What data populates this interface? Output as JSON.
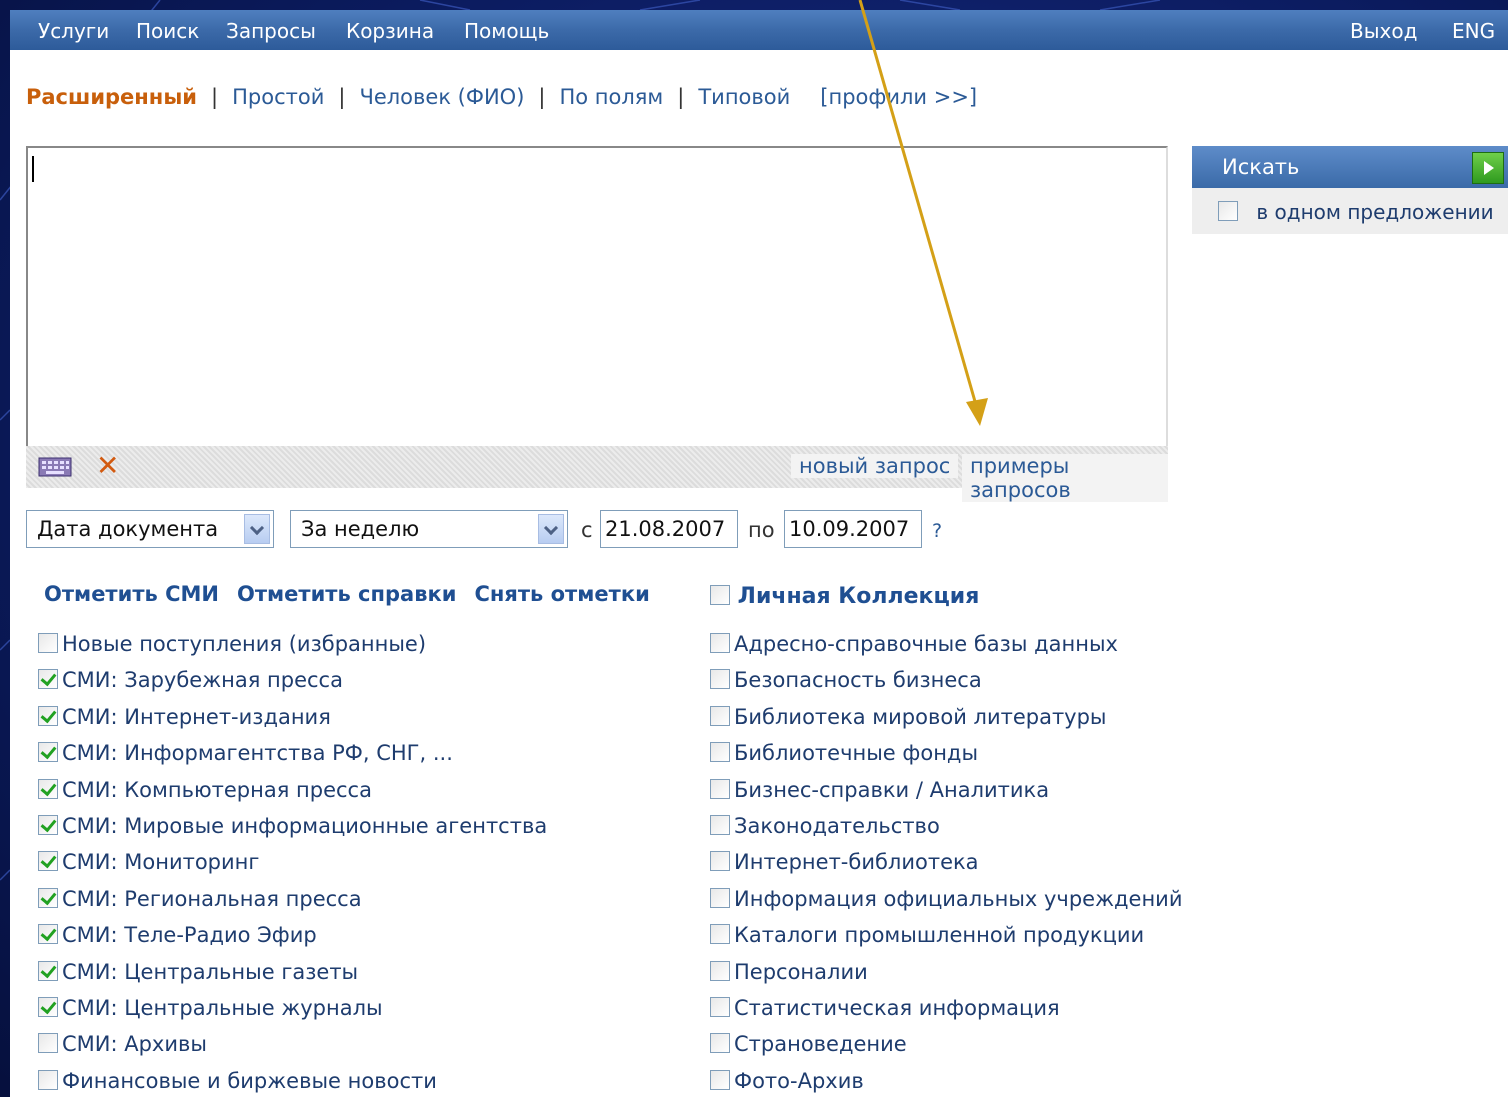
{
  "menu": {
    "items": [
      "Услуги",
      "Поиск",
      "Запросы",
      "Корзина",
      "Помощь"
    ],
    "logout": "Выход",
    "lang": "ENG"
  },
  "modes": {
    "extended": "Расширенный",
    "simple": "Простой",
    "person": "Человек (ФИО)",
    "by_fields": "По полям",
    "typical": "Типовой",
    "profiles": "[профили >>]",
    "separator": "|"
  },
  "query": {
    "value": "",
    "new_query": "новый запрос",
    "examples": "примеры запросов"
  },
  "search": {
    "button": "Искать",
    "in_one_sentence": "в одном предложении"
  },
  "filters": {
    "date_type": "Дата документа",
    "period": "За неделю",
    "from_label": "с",
    "from_date": "21.08.2007",
    "to_label": "по",
    "to_date": "10.09.2007",
    "help": "?"
  },
  "mark_links": {
    "mark_media": "Отметить СМИ",
    "mark_refs": "Отметить справки",
    "unmark": "Снять отметки"
  },
  "personal_collection": "Личная Коллекция",
  "left_collections": [
    {
      "label": "Новые поступления (избранные)",
      "checked": false
    },
    {
      "label": "СМИ: Зарубежная пресса",
      "checked": true
    },
    {
      "label": "СМИ: Интернет-издания",
      "checked": true
    },
    {
      "label": "СМИ: Информагентства РФ, СНГ, ...",
      "checked": true
    },
    {
      "label": "СМИ: Компьютерная пресса",
      "checked": true
    },
    {
      "label": "СМИ: Мировые информационные агентства",
      "checked": true
    },
    {
      "label": "СМИ: Мониторинг",
      "checked": true
    },
    {
      "label": "СМИ: Региональная пресса",
      "checked": true
    },
    {
      "label": "СМИ: Теле-Радио Эфир",
      "checked": true
    },
    {
      "label": "СМИ: Центральные газеты",
      "checked": true
    },
    {
      "label": "СМИ: Центральные журналы",
      "checked": true
    },
    {
      "label": "СМИ: Архивы",
      "checked": false
    },
    {
      "label": "Финансовые и биржевые новости",
      "checked": false
    }
  ],
  "right_collections": [
    {
      "label": "Адресно-справочные базы данных",
      "checked": false
    },
    {
      "label": "Безопасность бизнеса",
      "checked": false
    },
    {
      "label": "Библиотека мировой литературы",
      "checked": false
    },
    {
      "label": "Библиотечные фонды",
      "checked": false
    },
    {
      "label": "Бизнес-справки / Аналитика",
      "checked": false
    },
    {
      "label": "Законодательство",
      "checked": false
    },
    {
      "label": "Интернет-библиотека",
      "checked": false
    },
    {
      "label": "Информация официальных учреждений",
      "checked": false
    },
    {
      "label": "Каталоги промышленной продукции",
      "checked": false
    },
    {
      "label": "Персоналии",
      "checked": false
    },
    {
      "label": "Статистическая информация",
      "checked": false
    },
    {
      "label": "Страноведение",
      "checked": false
    },
    {
      "label": "Фото-Архив",
      "checked": false
    }
  ],
  "colors": {
    "slide_bg": "#0b1b5e",
    "menubar": "#3c6aa9",
    "active_mode": "#c85f0b",
    "link": "#2b5a96",
    "arrow": "#d4a017",
    "check": "#21a121"
  }
}
